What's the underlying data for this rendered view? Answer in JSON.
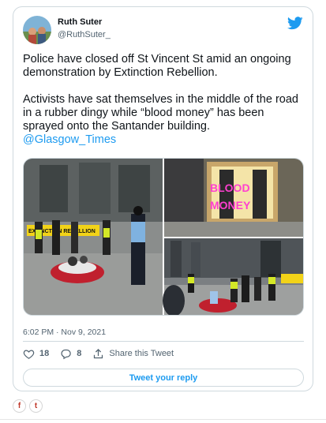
{
  "author": {
    "name": "Ruth Suter",
    "handle": "@RuthSuter_"
  },
  "tweet": {
    "paragraph1": "Police have closed off St Vincent St amid an ongoing demonstration by Extinction Rebellion.",
    "paragraph2": "Activists have sat themselves in the middle of the road in a rubber dingy while “blood money” has been sprayed onto the Santander building.",
    "mention": "@Glasgow_Times"
  },
  "media": {
    "banner_text": "EXTINCTION REBELLION",
    "graffiti_line1": "BLOOD",
    "graffiti_line2": "MONEY"
  },
  "timestamp": "6:02 PM · Nov 9, 2021",
  "actions": {
    "likes_count": "18",
    "replies_count": "8",
    "share_label": "Share this Tweet"
  },
  "reply_button_label": "Tweet your reply",
  "share_buttons": {
    "facebook_glyph": "f",
    "twitter_glyph": "t"
  },
  "colors": {
    "link_blue": "#1d9bf0",
    "border": "#cfd9de",
    "secondary_text": "#536471",
    "xr_yellow": "#f2d318",
    "graffiti_pink": "#ff3fd0"
  },
  "icons": [
    "twitter-bird-icon",
    "heart-icon",
    "reply-bubble-icon",
    "share-icon",
    "facebook-icon",
    "twitter-icon"
  ]
}
